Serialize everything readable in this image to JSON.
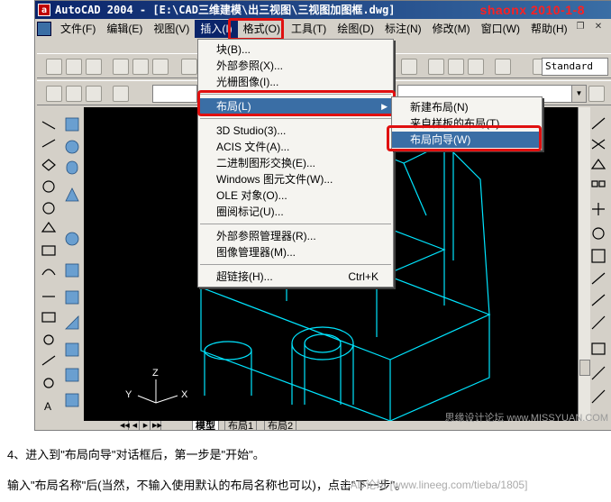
{
  "window": {
    "title": "AutoCAD 2004 - [E:\\CAD三维建模\\出三视图\\三视图加图框.dwg]",
    "watermark": "shaonx 2010-1-8"
  },
  "menubar": {
    "items": [
      "文件(F)",
      "编辑(E)",
      "视图(V)",
      "插入(I)",
      "格式(O)",
      "工具(T)",
      "绘图(D)",
      "标注(N)",
      "修改(M)",
      "窗口(W)",
      "帮助(H)"
    ],
    "active_index": 3
  },
  "toolbar": {
    "text_style": "Standard"
  },
  "insert_menu": {
    "groups": [
      [
        {
          "label": "块(B)..."
        },
        {
          "label": "外部参照(X)..."
        },
        {
          "label": "光栅图像(I)..."
        }
      ],
      [
        {
          "label": "布局(L)",
          "submenu": true,
          "selected": true
        }
      ],
      [
        {
          "label": "3D Studio(3)..."
        },
        {
          "label": "ACIS 文件(A)..."
        },
        {
          "label": "二进制图形交换(E)..."
        },
        {
          "label": "Windows 图元文件(W)..."
        },
        {
          "label": "OLE 对象(O)..."
        },
        {
          "label": "圈阅标记(U)..."
        }
      ],
      [
        {
          "label": "外部参照管理器(R)..."
        },
        {
          "label": "图像管理器(M)..."
        }
      ],
      [
        {
          "label": "超链接(H)...",
          "shortcut": "Ctrl+K"
        }
      ]
    ]
  },
  "layout_submenu": {
    "items": [
      {
        "label": "新建布局(N)"
      },
      {
        "label": "来自样板的布局(T)..."
      },
      {
        "label": "布局向导(W)",
        "selected": true
      }
    ]
  },
  "tabs": {
    "nav": [
      "◀◀",
      "◀",
      "▶",
      "▶▶"
    ],
    "items": [
      "模型",
      "布局1",
      "布局2"
    ],
    "active_index": 0
  },
  "ucs": {
    "x": "X",
    "y": "Y",
    "z": "Z"
  },
  "bottom_watermark": "思缘设计论坛 www.MISSYUAN.COM",
  "caption": {
    "line1": "4、进入到\"布局向导\"对话框后，第一步是\"开始\"。",
    "line2": "输入\"布局名称\"后(当然，不输入使用默认的布局名称也可以)，点击\"下一步\"。",
    "line2_watermark": "CAD论坛 [www.lineeg.com/tieba/1805]"
  }
}
